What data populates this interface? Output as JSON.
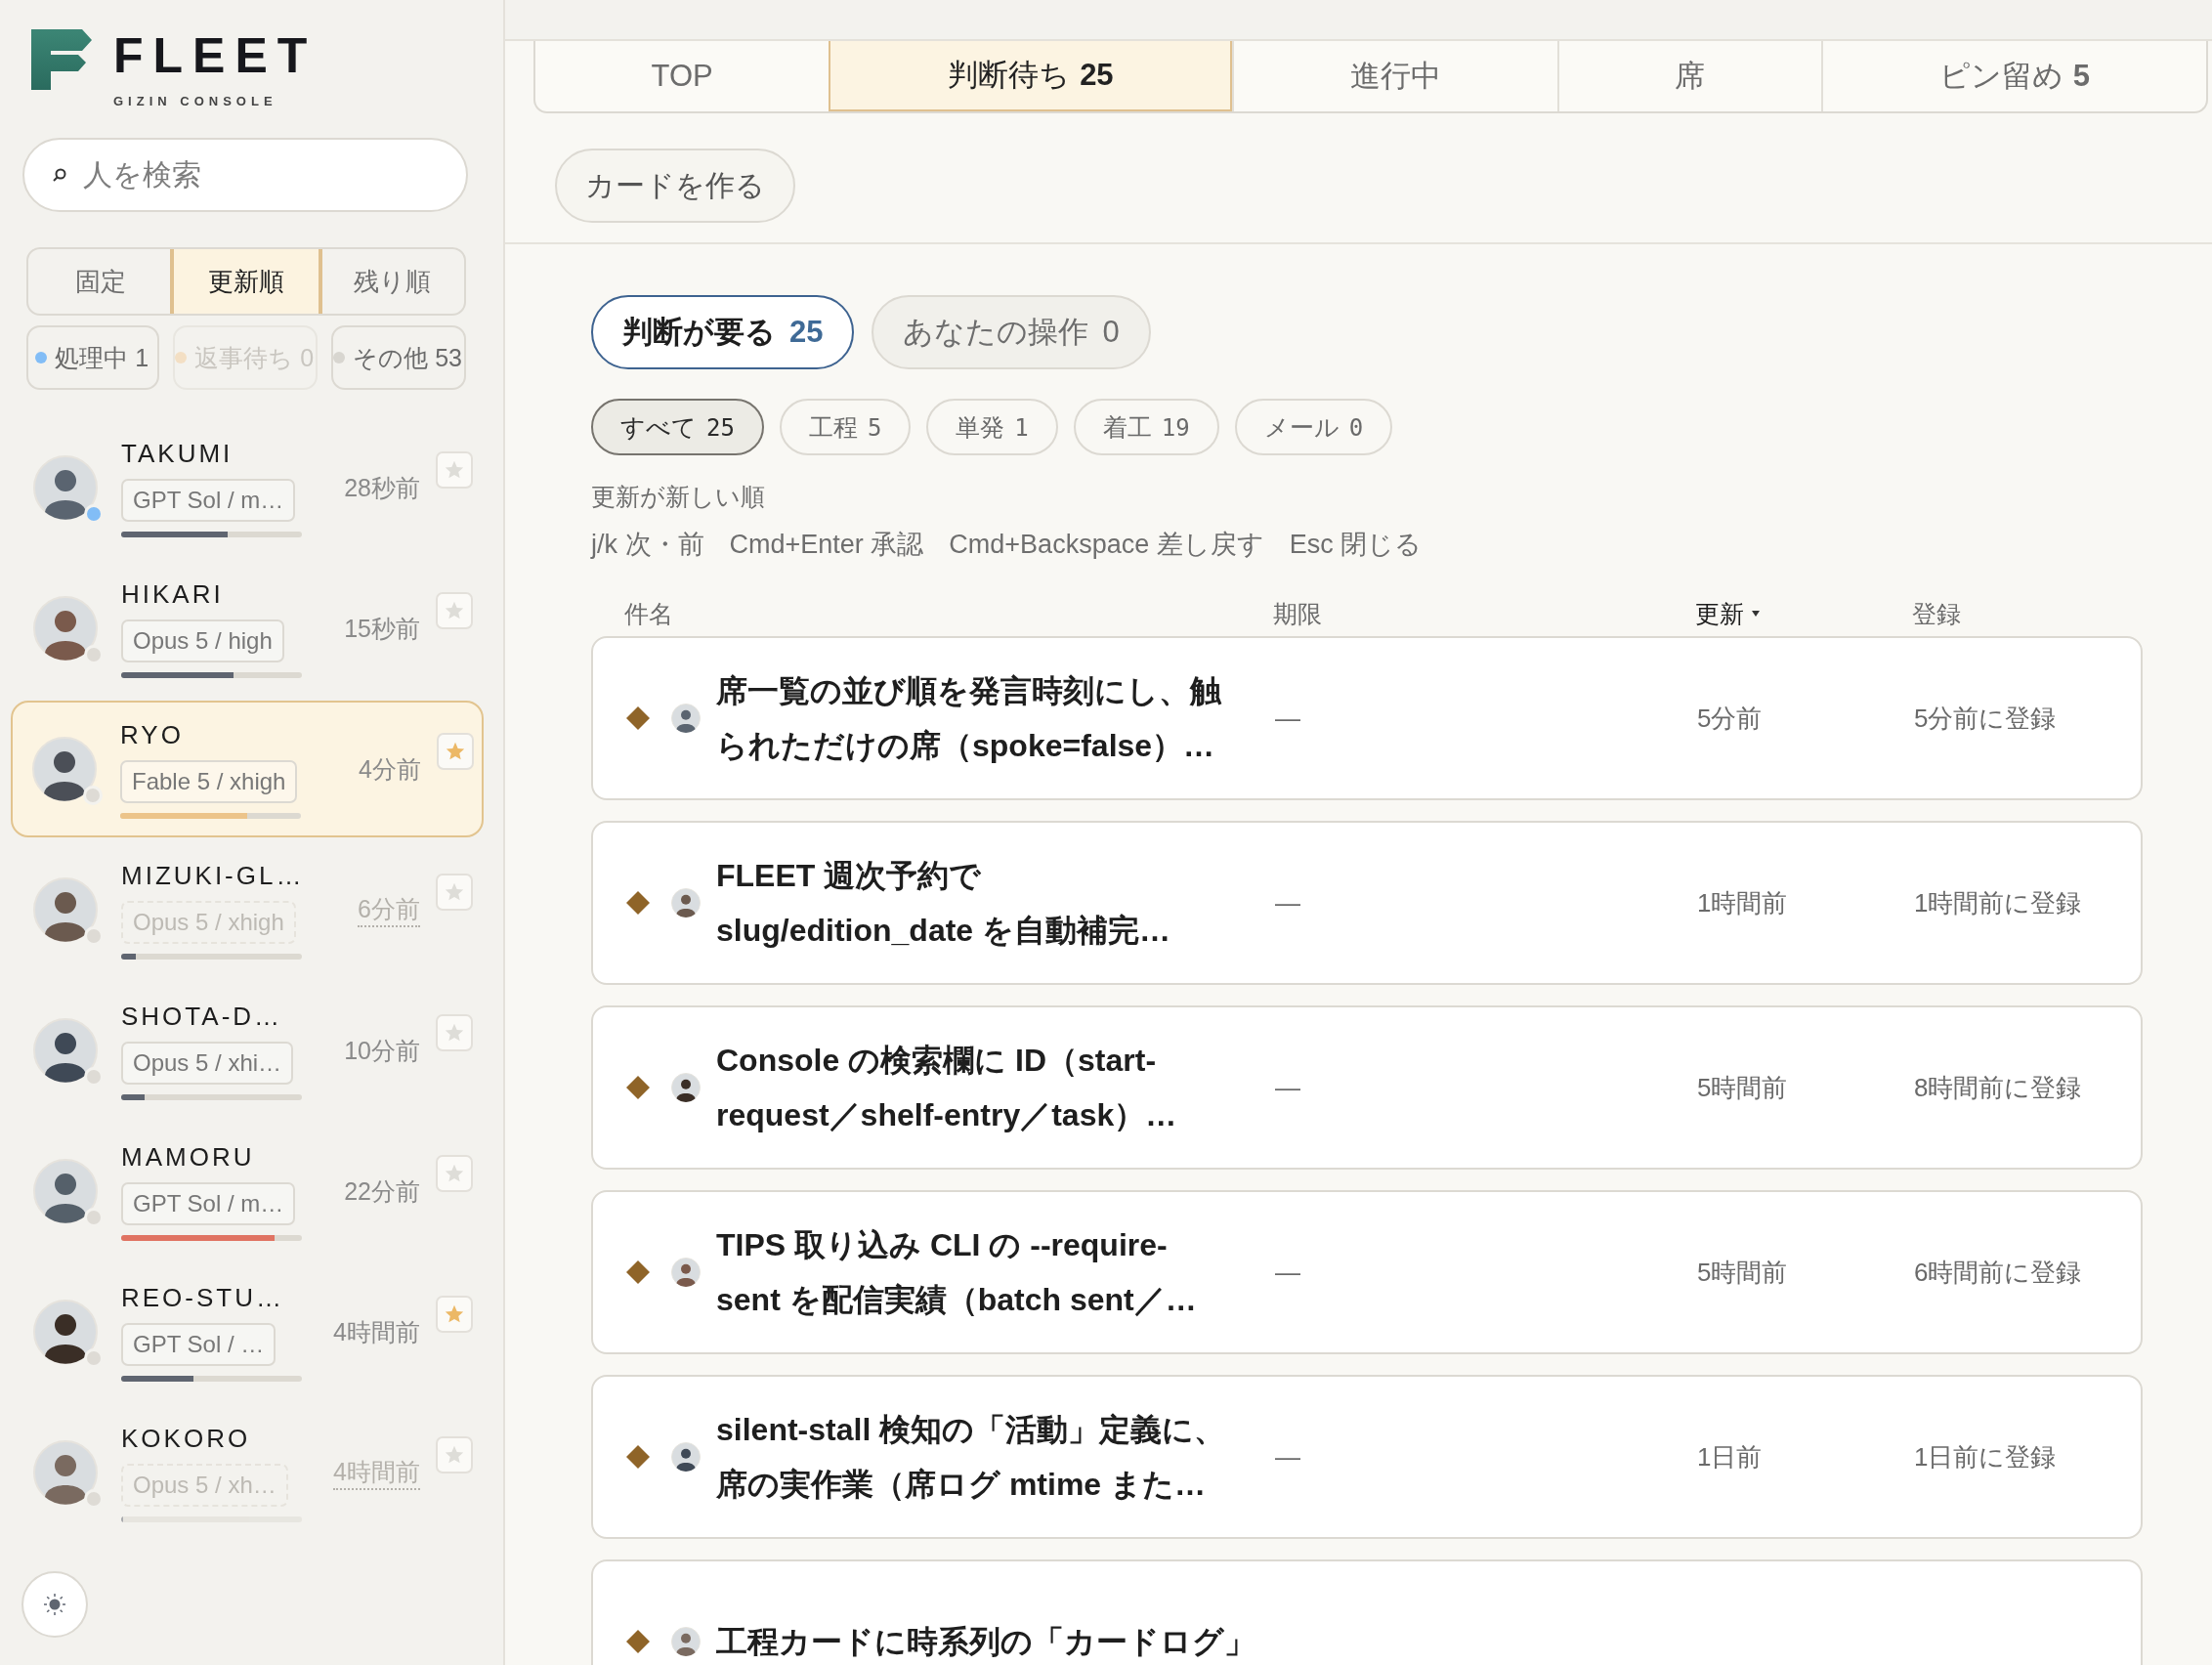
{
  "logo": {
    "name": "FLEET",
    "subtitle": "GIZIN CONSOLE"
  },
  "sidebar": {
    "search": {
      "placeholder": "人を検索"
    },
    "sort_options": [
      {
        "label": "固定",
        "selected": false
      },
      {
        "label": "更新順",
        "selected": true
      },
      {
        "label": "残り順",
        "selected": false
      }
    ],
    "status_filters": [
      {
        "label": "処理中 1",
        "color": "#82bdf6",
        "disabled": false
      },
      {
        "label": "返事待ち 0",
        "color": "#f3dfc4",
        "disabled": true
      },
      {
        "label": "その他 53",
        "color": "#d8d6d0",
        "disabled": false
      }
    ],
    "people": [
      {
        "name": "TAKUMI",
        "model": "GPT Sol / m…",
        "time": "28秒前",
        "level": 0.59,
        "color": "#82bdf6",
        "pinned": false,
        "idle": false,
        "selected": false
      },
      {
        "name": "HIKARI",
        "model": "Opus 5 / high",
        "time": "15秒前",
        "level": 0.62,
        "color": "#dedbd5",
        "pinned": false,
        "idle": false,
        "selected": false
      },
      {
        "name": "RYO",
        "model": "Fable 5 / xhigh",
        "time": "4分前",
        "level": 0.7,
        "color": "#dedbd5",
        "pinned": true,
        "idle": false,
        "selected": true
      },
      {
        "name": "MIZUKI-GL…",
        "model": "Opus 5 / xhigh",
        "time": "6分前",
        "level": 0.08,
        "color": "#dedbd5",
        "pinned": false,
        "idle": true,
        "selected": false
      },
      {
        "name": "SHOTA-D…",
        "model": "Opus 5 / xhi…",
        "time": "10分前",
        "level": 0.13,
        "color": "#dedbd5",
        "pinned": false,
        "idle": false,
        "selected": false
      },
      {
        "name": "MAMORU",
        "model": "GPT Sol / m…",
        "time": "22分前",
        "level": 0.85,
        "color": "#dedbd5",
        "pinned": false,
        "idle": false,
        "selected": false
      },
      {
        "name": "REO-STU…",
        "model": "GPT Sol / …",
        "time": "4時間前",
        "level": 0.4,
        "color": "#dedbd5",
        "pinned": true,
        "idle": false,
        "selected": false
      },
      {
        "name": "KOKORO",
        "model": "Opus 5 / xh…",
        "time": "4時間前",
        "level": 0,
        "color": "#dedbd5",
        "pinned": false,
        "idle": true,
        "selected": false
      }
    ]
  },
  "tabs": [
    {
      "label": "TOP",
      "selected": false
    },
    {
      "label": "判断待ち",
      "count": "25",
      "selected": true
    },
    {
      "label": "進行中",
      "selected": false
    },
    {
      "label": "席",
      "selected": false
    },
    {
      "label": "ピン留め",
      "count": "5",
      "selected": false
    }
  ],
  "create_button": "カードを作る",
  "scope_pills": [
    {
      "label": "判断が要る",
      "count": "25",
      "selected": true
    },
    {
      "label": "あなたの操作",
      "count": "0",
      "selected": false
    }
  ],
  "type_filters": [
    {
      "label": "すべて",
      "count": "25",
      "selected": true
    },
    {
      "label": "工程",
      "count": "5",
      "selected": false
    },
    {
      "label": "単発",
      "count": "1",
      "selected": false
    },
    {
      "label": "着工",
      "count": "19",
      "selected": false
    },
    {
      "label": "メール",
      "count": "0",
      "selected": false
    }
  ],
  "sort_label": "更新が新しい順",
  "shortcuts": [
    "j/k 次・前",
    "Cmd+Enter 承認",
    "Cmd+Backspace 差し戻す",
    "Esc 閉じる"
  ],
  "table": {
    "columns": [
      {
        "label": "件名",
        "sorted": false
      },
      {
        "label": "期限",
        "sorted": false
      },
      {
        "label": "更新",
        "sorted": true
      },
      {
        "label": "登録",
        "sorted": false
      }
    ],
    "rows": [
      {
        "title_lines": [
          "席一覧の並び順を発言時刻にし、触",
          "られただけの席（spoke=false）…"
        ],
        "deadline": "—",
        "updated": "5分前",
        "registered": "5分前に登録"
      },
      {
        "title_lines": [
          "FLEET 週次予約で",
          "slug/edition_date を自動補完…"
        ],
        "deadline": "—",
        "updated": "1時間前",
        "registered": "1時間前に登録"
      },
      {
        "title_lines": [
          "Console の検索欄に ID（start-",
          "request／shelf-entry／task）…"
        ],
        "deadline": "—",
        "updated": "5時間前",
        "registered": "8時間前に登録"
      },
      {
        "title_lines": [
          "TIPS 取り込み CLI の --require-",
          "sent を配信実績（batch sent／…"
        ],
        "deadline": "—",
        "updated": "5時間前",
        "registered": "6時間前に登録"
      },
      {
        "title_lines": [
          "silent-stall 検知の「活動」定義に、",
          "席の実作業（席ログ mtime また…"
        ],
        "deadline": "—",
        "updated": "1日前",
        "registered": "1日前に登録"
      },
      {
        "title_lines": [
          "工程カードに時系列の「カードログ」"
        ]
      }
    ]
  }
}
